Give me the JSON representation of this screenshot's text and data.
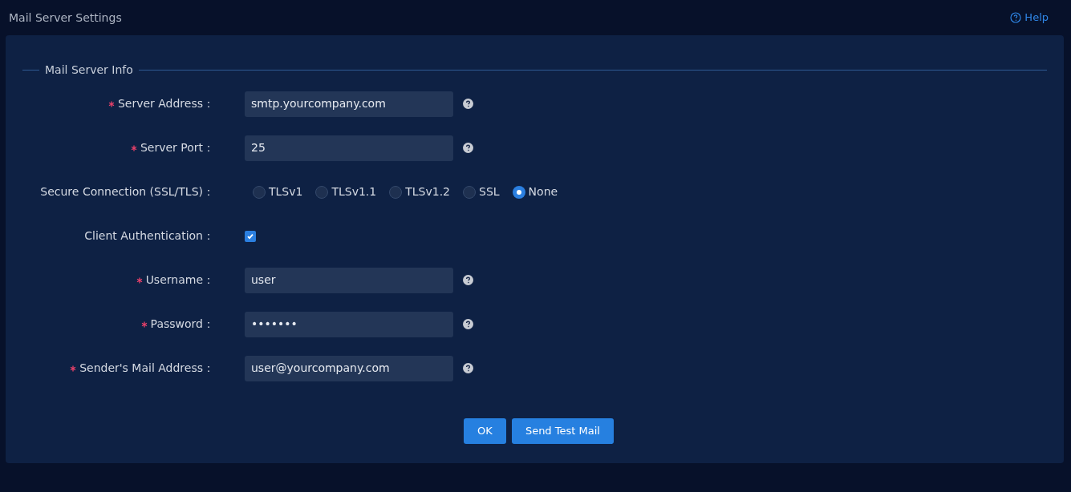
{
  "page": {
    "title": "Mail Server Settings",
    "help": "Help"
  },
  "section": {
    "title": "Mail Server Info"
  },
  "rows": [
    {
      "kind": "field",
      "label": "Server Address：",
      "required": true,
      "value": "smtp.yourcompany.com"
    },
    {
      "kind": "field",
      "label": "Server Port：",
      "required": true,
      "value": "25"
    },
    {
      "kind": "radio",
      "label": "Secure Connection (SSL/TLS)：",
      "required": false,
      "options": [
        {
          "label": "TLSv1",
          "selected": false
        },
        {
          "label": "TLSv1.1",
          "selected": false
        },
        {
          "label": "TLSv1.2",
          "selected": false
        },
        {
          "label": "SSL",
          "selected": false
        },
        {
          "label": "None",
          "selected": true
        }
      ]
    },
    {
      "kind": "checkbox",
      "label": "Client Authentication：",
      "required": false,
      "checked": true
    },
    {
      "kind": "field",
      "label": "Username：",
      "required": true,
      "value": "user"
    },
    {
      "kind": "field",
      "label": "Password：",
      "required": true,
      "value": "•••••••"
    },
    {
      "kind": "field",
      "label": "Sender's Mail Address：",
      "required": true,
      "value": "user@yourcompany.com"
    }
  ],
  "buttons": [
    {
      "label": "OK"
    },
    {
      "label": "Send Test Mail"
    }
  ]
}
